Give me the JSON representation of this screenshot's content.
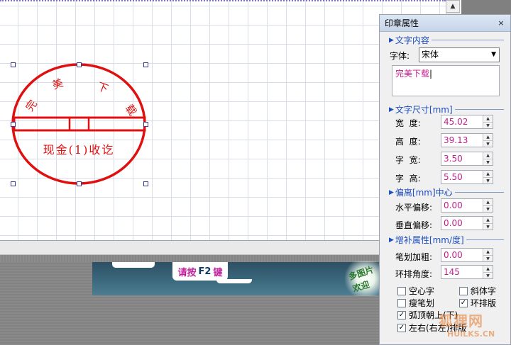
{
  "stamp": {
    "text_top": "完美下载",
    "text_bottom": "现金(1)收讫",
    "color": "#e01010"
  },
  "banner": {
    "press_label": "请按",
    "key": "F2",
    "key_suffix": "键",
    "script_text": "多图片 欢迎"
  },
  "panel": {
    "title": "印章属性",
    "close_icon": "×",
    "text_section": {
      "label": "文字内容",
      "font_label": "字体:",
      "font_value": "宋体",
      "text_value": "完美下载"
    },
    "size_section": {
      "label": "文字尺寸[mm]",
      "fields": [
        {
          "label": "宽  度:",
          "value": "45.02"
        },
        {
          "label": "高  度:",
          "value": "39.13"
        },
        {
          "label": "字  宽:",
          "value": "3.50"
        },
        {
          "label": "字  高:",
          "value": "5.50"
        }
      ]
    },
    "offset_section": {
      "label": "偏离[mm]中心",
      "fields": [
        {
          "label": "水平偏移:",
          "value": "0.00"
        },
        {
          "label": "垂直偏移:",
          "value": "0.00"
        }
      ]
    },
    "extra_section": {
      "label": "增补属性[mm/度]",
      "fields": [
        {
          "label": "笔划加粗:",
          "value": "0.00"
        },
        {
          "label": "环排角度:",
          "value": "145"
        }
      ]
    },
    "checkboxes": [
      {
        "label": "空心字",
        "checked": false
      },
      {
        "label": "斜体字",
        "checked": false
      },
      {
        "label": "瘦笔划",
        "checked": false
      },
      {
        "label": "环排版",
        "checked": true
      },
      {
        "label": "弧顶朝上(下)",
        "checked": true
      },
      {
        "label": "左右(右左)排版",
        "checked": true
      }
    ]
  },
  "watermark": {
    "line1": "狐狸网",
    "line2": "HUILKS.CN"
  },
  "colors": {
    "accent_blue": "#1e4fc0",
    "value_magenta": "#c0208a",
    "stamp_red": "#e01010"
  }
}
